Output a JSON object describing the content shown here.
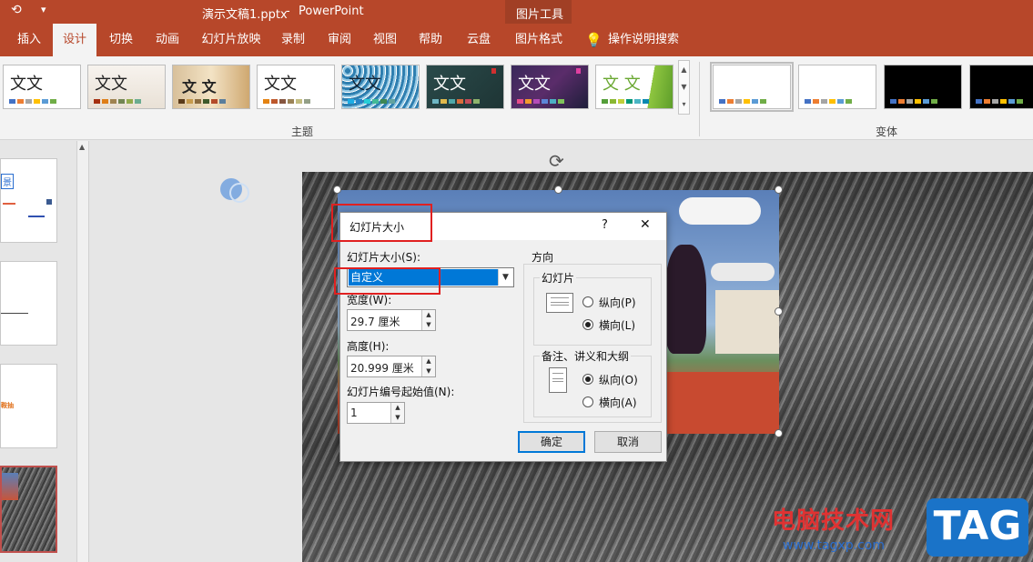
{
  "titlebar": {
    "filename": "演示文稿1.pptx",
    "separator": "-",
    "app": "PowerPoint",
    "context_tools": "图片工具",
    "qat_dropdown": "▾"
  },
  "ribbon_tabs": {
    "items": [
      "插入",
      "设计",
      "切换",
      "动画",
      "幻灯片放映",
      "录制",
      "审阅",
      "视图",
      "帮助",
      "云盘",
      "图片格式"
    ],
    "active": "设计",
    "tell_me": "操作说明搜索"
  },
  "ribbon": {
    "themes_label": "主题",
    "variants_label": "变体",
    "theme_sample_text": "文文",
    "theme_sample_alt": "文 文",
    "theme_sample_green": "文 文"
  },
  "slide_panel": {
    "thumb1_text": "景",
    "thumb3_text": "鞍抽"
  },
  "dialog": {
    "title": "幻灯片大小",
    "help": "?",
    "close": "✕",
    "size_label": "幻灯片大小(S):",
    "size_value": "自定义",
    "width_label": "宽度(W):",
    "width_value": "29.7 厘米",
    "height_label": "高度(H):",
    "height_value": "20.999 厘米",
    "start_label": "幻灯片编号起始值(N):",
    "start_value": "1",
    "orientation_label": "方向",
    "slides_group": "幻灯片",
    "portrait": "纵向(P)",
    "landscape": "横向(L)",
    "notes_group": "备注、讲义和大纲",
    "notes_portrait": "纵向(O)",
    "notes_landscape": "横向(A)",
    "slides_orientation_selected": "landscape",
    "notes_orientation_selected": "portrait",
    "ok": "确定",
    "cancel": "取消"
  },
  "watermark": {
    "site_cn": "电脑技术网",
    "url": "www.tagxp.com",
    "tag": "TAG"
  },
  "colors": {
    "accent": "#b7472a",
    "selection": "#0078d7",
    "highlight_box": "#e02020"
  }
}
